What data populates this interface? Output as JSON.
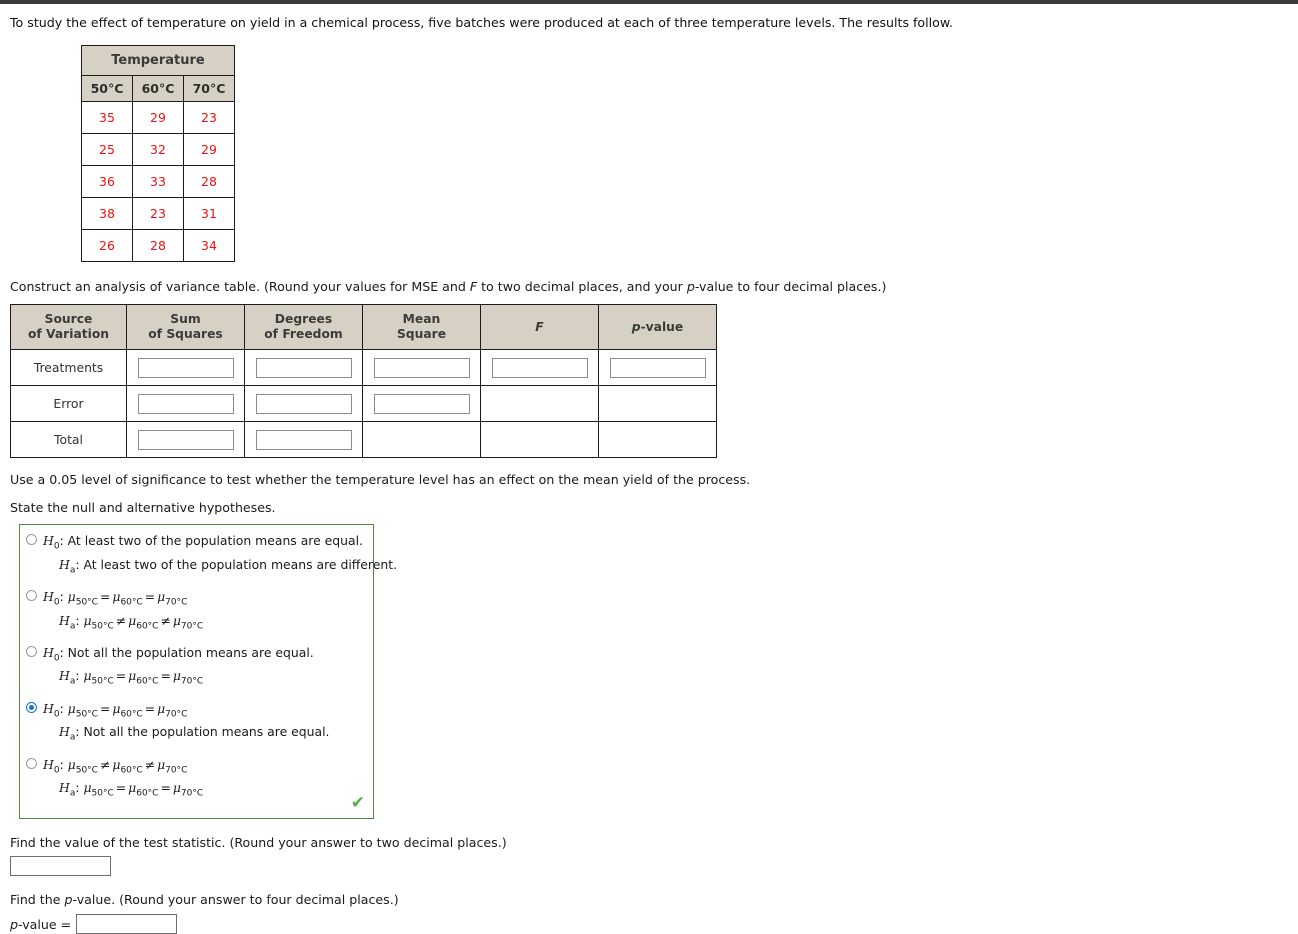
{
  "prompt": "To study the effect of temperature on yield in a chemical process, five batches were produced at each of three temperature levels. The results follow.",
  "data_table": {
    "group_header": "Temperature",
    "columns": [
      "50°C",
      "60°C",
      "70°C"
    ],
    "rows": [
      [
        "35",
        "29",
        "23"
      ],
      [
        "25",
        "32",
        "29"
      ],
      [
        "36",
        "33",
        "28"
      ],
      [
        "38",
        "23",
        "31"
      ],
      [
        "26",
        "28",
        "34"
      ]
    ]
  },
  "anova_intro_parts": {
    "a": "Construct an analysis of variance table. (Round your values for MSE and ",
    "f": "F",
    "b": " to two decimal places, and your ",
    "p": "p",
    "c": "-value to four decimal places.)"
  },
  "anova_table": {
    "headers": [
      {
        "line1": "Source",
        "line2": "of Variation"
      },
      {
        "line1": "Sum",
        "line2": "of Squares"
      },
      {
        "line1": "Degrees",
        "line2": "of Freedom"
      },
      {
        "line1": "Mean",
        "line2": "Square"
      },
      {
        "line1": "F",
        "line2": ""
      },
      {
        "line1": "p-value",
        "line2": ""
      }
    ],
    "rows": [
      {
        "label": "Treatments",
        "inputs": [
          true,
          true,
          true,
          true,
          true
        ],
        "values": [
          "",
          "",
          "",
          "",
          ""
        ]
      },
      {
        "label": "Error",
        "inputs": [
          true,
          true,
          true,
          false,
          false
        ],
        "values": [
          "",
          "",
          "",
          "",
          ""
        ]
      },
      {
        "label": "Total",
        "inputs": [
          true,
          true,
          false,
          false,
          false
        ],
        "values": [
          "",
          "",
          "",
          "",
          ""
        ]
      }
    ]
  },
  "significance_text": "Use a 0.05 level of significance to test whether the temperature level has an effect on the mean yield of the process.",
  "state_hypotheses_text": "State the null and alternative hypotheses.",
  "hypotheses": {
    "selected_index": 3,
    "options": [
      {
        "null_prefix": "H",
        "null_sub": "0",
        "null_text": ": At least two of the population means are equal.",
        "alt_prefix": "H",
        "alt_sub": "a",
        "alt_text": ": At least two of the population means are different.",
        "null_is_formula": false,
        "alt_is_formula": false
      },
      {
        "null_prefix": "H",
        "null_sub": "0",
        "null_text": "",
        "alt_prefix": "H",
        "alt_sub": "a",
        "alt_text": "",
        "null_is_formula": true,
        "alt_is_formula": true,
        "null_ops": [
          "=",
          "="
        ],
        "alt_ops": [
          "≠",
          "≠"
        ]
      },
      {
        "null_prefix": "H",
        "null_sub": "0",
        "null_text": ": Not all the population means are equal.",
        "alt_prefix": "H",
        "alt_sub": "a",
        "alt_text": "",
        "null_is_formula": false,
        "alt_is_formula": true,
        "alt_ops": [
          "=",
          "="
        ]
      },
      {
        "null_prefix": "H",
        "null_sub": "0",
        "null_text": "",
        "alt_prefix": "H",
        "alt_sub": "a",
        "alt_text": ": Not all the population means are equal.",
        "null_is_formula": true,
        "alt_is_formula": false,
        "null_ops": [
          "=",
          "="
        ]
      },
      {
        "null_prefix": "H",
        "null_sub": "0",
        "null_text": "",
        "alt_prefix": "H",
        "alt_sub": "a",
        "alt_text": "",
        "null_is_formula": true,
        "alt_is_formula": true,
        "null_ops": [
          "≠",
          "≠"
        ],
        "alt_ops": [
          "=",
          "="
        ]
      }
    ],
    "mu_subscripts": [
      "50°C",
      "60°C",
      "70°C"
    ],
    "correct_icon": "✔",
    "correct_color": "#5aab4e",
    "box_border_color": "#4e8a3f"
  },
  "test_statistic": {
    "question": "Find the value of the test statistic. (Round your answer to two decimal places.)",
    "value": "",
    "placeholder": ""
  },
  "p_value_section": {
    "question_a": "Find the ",
    "question_p": "p",
    "question_b": "-value. (Round your answer to four decimal places.)",
    "label_p": "p",
    "label_rest": "-value =",
    "value": "",
    "placeholder": ""
  },
  "colors": {
    "header_bg": "#d6d1c4",
    "data_value": "#ee1111",
    "radio_selected": "#1173d4",
    "topbar": "#3b3b3b"
  }
}
